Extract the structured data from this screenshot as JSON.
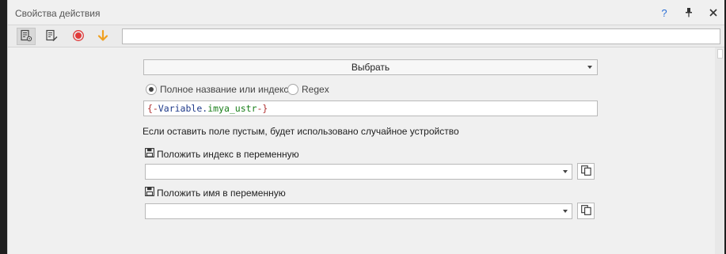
{
  "window": {
    "title": "Свойства действия",
    "help_icon": "?",
    "accent_help": "#2b6fd6"
  },
  "toolbar": {
    "buttons": [
      {
        "icon": "document-settings-icon",
        "active": true
      },
      {
        "icon": "document-edit-icon",
        "active": false
      },
      {
        "icon": "record-icon",
        "color": "#e03a3a"
      },
      {
        "icon": "arrow-down-icon",
        "color": "#f0a020"
      }
    ],
    "search_value": ""
  },
  "form": {
    "select_button_label": "Выбрать",
    "radio_full_name_label": "Полное название или индекс:",
    "radio_regex_label": "Regex",
    "radio_selected": "full_name",
    "variable_value": {
      "open": "{-",
      "var": "Variable",
      "dot": ".",
      "name": "imya_ustr",
      "close": "-}"
    },
    "hint_text": "Если оставить поле пустым, будет использовано случайное устройство",
    "index_label": "Положить индекс в переменную",
    "index_value": "",
    "name_label": "Положить имя в переменную",
    "name_value": ""
  }
}
